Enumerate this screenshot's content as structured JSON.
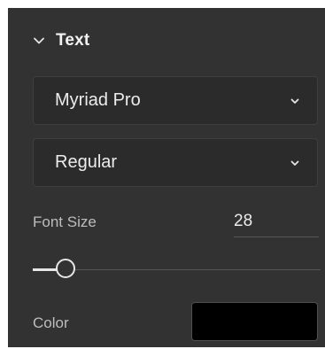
{
  "text_section": {
    "title": "Text",
    "expanded": true,
    "font_family": {
      "selected": "Myriad Pro"
    },
    "font_style": {
      "selected": "Regular"
    },
    "font_size": {
      "label": "Font Size",
      "value": "28"
    },
    "size_slider": {
      "level": 0.115
    },
    "color": {
      "label": "Color",
      "value": "#000000"
    }
  },
  "colors": {
    "panel_bg": "#323232",
    "accent_text": "#f2f2f2"
  },
  "icons": {
    "section_toggle": "chevron-down-icon",
    "dropdown": "chevron-down-icon"
  }
}
